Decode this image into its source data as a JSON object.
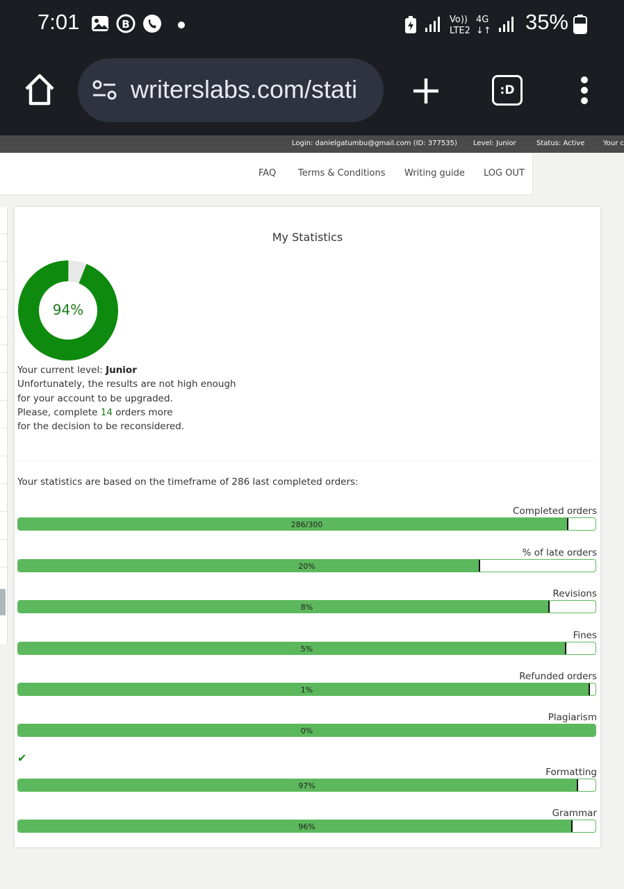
{
  "status_bar": {
    "time": "7:01",
    "battery": "35%",
    "network_label": "Vo)) LTE2 4G"
  },
  "browser": {
    "url": "writerslabs.com/stati",
    "tab_icon_label": ":D"
  },
  "info_bar": {
    "login": "Login: danielgatumbu@gmail.com (ID: 377535)",
    "level": "Level: Junior",
    "status": "Status: Active",
    "extra": "Your c"
  },
  "nav": {
    "faq": "FAQ",
    "terms": "Terms & Conditions",
    "guide": "Writing guide",
    "logout": "LOG OUT"
  },
  "stats": {
    "title": "My Statistics",
    "score_percent": 94,
    "score_text": "94%",
    "level_prefix": "Your current level:",
    "level": "Junior",
    "line1": "Unfortunately, the results are not high enough",
    "line2": "for your account to be upgraded.",
    "line3_prefix": "Please, complete",
    "orders_needed": "14",
    "line3_suffix": "orders more",
    "line4": "for the decision to be reconsidered.",
    "timeframe": "Your statistics are based on the timeframe of 286 last completed orders:",
    "checkmark": "✔"
  },
  "bars": [
    {
      "label": "Completed orders",
      "text": "286/300",
      "fill": 0.953
    },
    {
      "label": "% of late orders",
      "text": "20%",
      "fill": 0.8
    },
    {
      "label": "Revisions",
      "text": "8%",
      "fill": 0.92
    },
    {
      "label": "Fines",
      "text": "5%",
      "fill": 0.95
    },
    {
      "label": "Refunded orders",
      "text": "1%",
      "fill": 0.99
    },
    {
      "label": "Plagiarism",
      "text": "0%",
      "fill": 1.0
    },
    {
      "label": "Formatting",
      "text": "97%",
      "fill": 0.97
    },
    {
      "label": "Grammar",
      "text": "96%",
      "fill": 0.96
    }
  ],
  "colors": {
    "accent_green": "#5cb85c",
    "donut_green": "#0e8a0e",
    "donut_bg": "#e8e8e8"
  }
}
